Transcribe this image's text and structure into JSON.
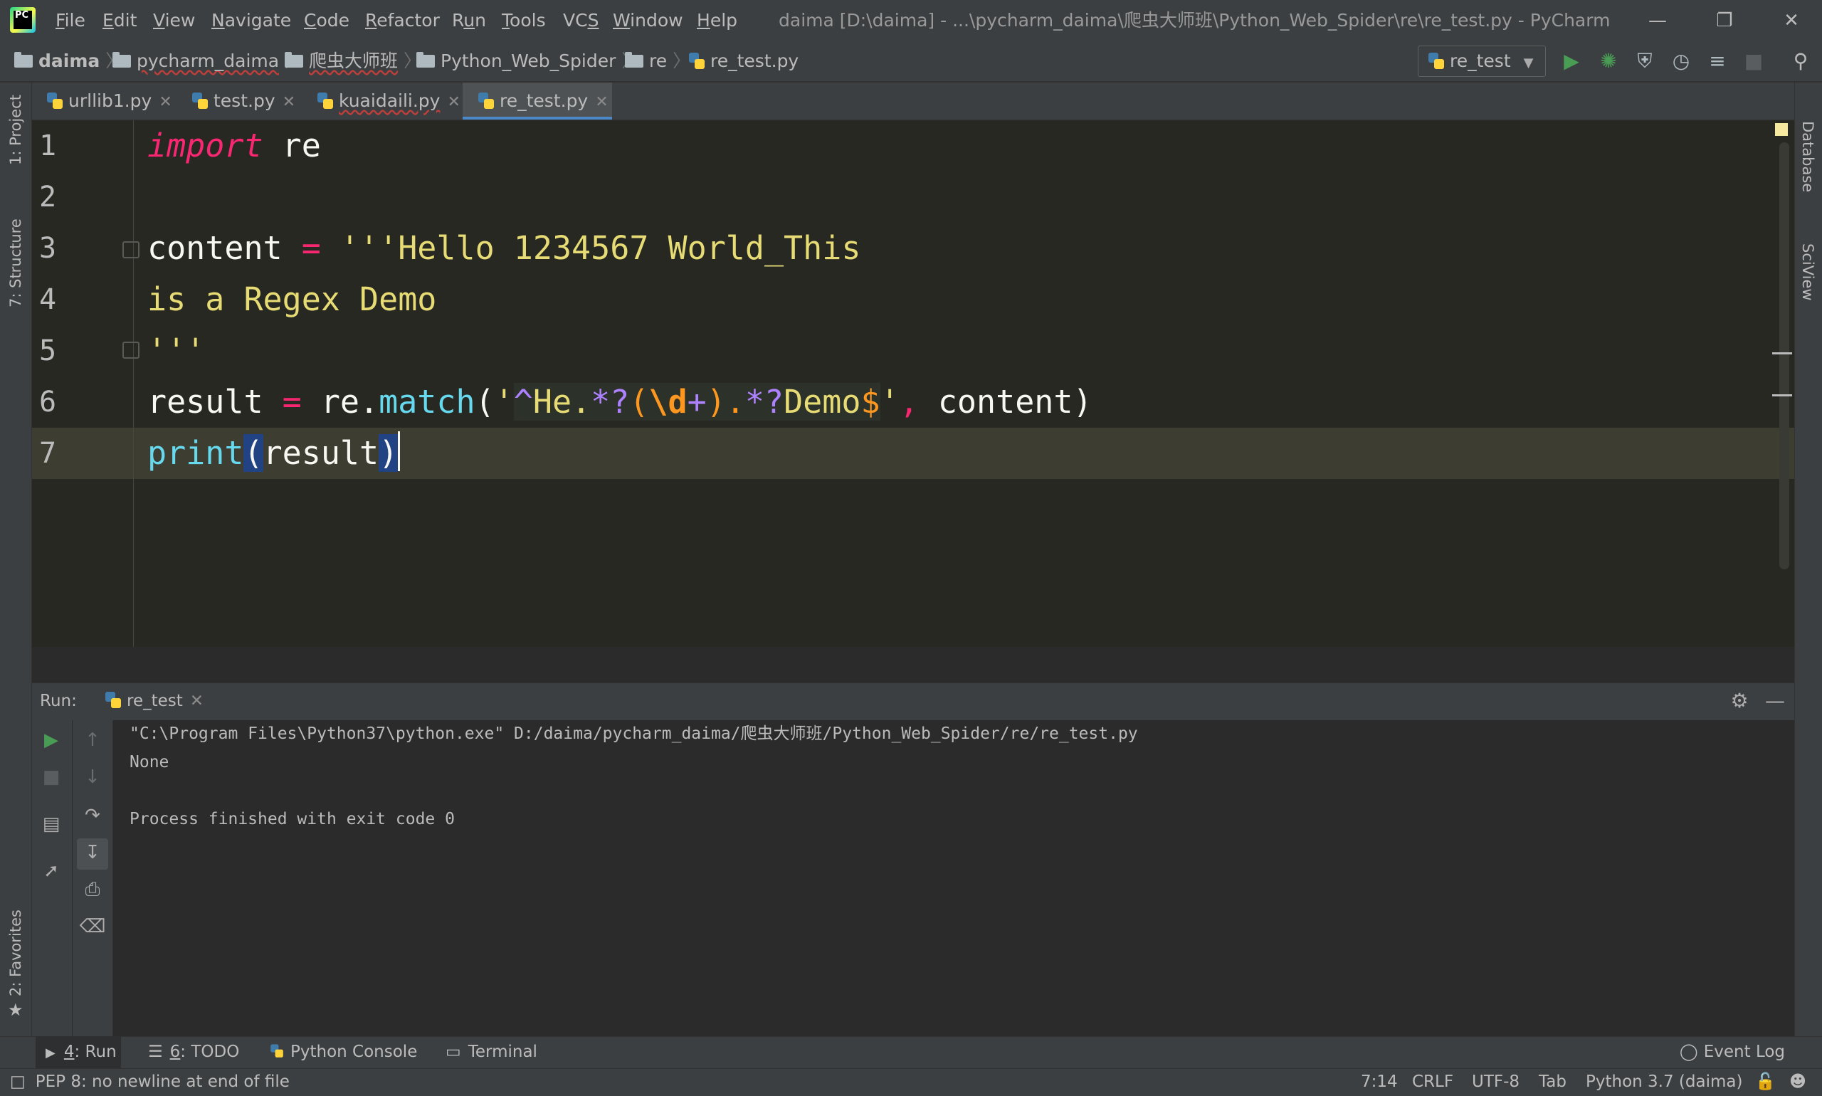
{
  "menu": {
    "items": [
      {
        "pre": "",
        "u": "F",
        "post": "ile"
      },
      {
        "pre": "",
        "u": "E",
        "post": "dit"
      },
      {
        "pre": "",
        "u": "V",
        "post": "iew"
      },
      {
        "pre": "",
        "u": "N",
        "post": "avigate"
      },
      {
        "pre": "",
        "u": "C",
        "post": "ode"
      },
      {
        "pre": "",
        "u": "R",
        "post": "efactor"
      },
      {
        "pre": "R",
        "u": "u",
        "post": "n"
      },
      {
        "pre": "",
        "u": "T",
        "post": "ools"
      },
      {
        "pre": "VC",
        "u": "S",
        "post": ""
      },
      {
        "pre": "",
        "u": "W",
        "post": "indow"
      },
      {
        "pre": "",
        "u": "H",
        "post": "elp"
      }
    ]
  },
  "window_title": "daima [D:\\daima] - ...\\pycharm_daima\\爬虫大师班\\Python_Web_Spider\\re\\re_test.py - PyCharm",
  "breadcrumb": [
    "daima",
    "pycharm_daima",
    "爬虫大师班",
    "Python_Web_Spider",
    "re",
    "re_test.py"
  ],
  "run_config": "re_test",
  "tabs": [
    "urllib1.py",
    "test.py",
    "kuaidaili.py",
    "re_test.py"
  ],
  "active_tab": "re_test.py",
  "editor": {
    "line_numbers": [
      "1",
      "2",
      "3",
      "4",
      "5",
      "6",
      "7"
    ],
    "line1": {
      "kw": "import",
      "rest": " re"
    },
    "line3": {
      "ident": "content ",
      "op": "=",
      "str": " '''Hello 1234567 World_This"
    },
    "line4": {
      "str": "is a Regex Demo"
    },
    "line5": {
      "str": "'''"
    },
    "line6": {
      "a": "result ",
      "op": "=",
      "b": " re.",
      "fn": "match",
      "c": "(",
      "q1": "'",
      "rx1": "^",
      "rx2": "He.",
      "rx3": "*?",
      "rx4": "(",
      "rx5": "\\d",
      "rx6": "+",
      "rx7": ").",
      "rx8": "*?",
      "rx9": "Demo",
      "rx10": "$",
      "q2": "'",
      "comma": ",",
      "d": " content)"
    },
    "line7": {
      "fn": "print",
      "open": "(",
      "arg": "result",
      "close": ")"
    }
  },
  "left_stripe": [
    "1: Project",
    "7: Structure",
    "2: Favorites"
  ],
  "right_stripe": [
    "Database",
    "SciView"
  ],
  "run": {
    "label": "Run:",
    "tab": "re_test",
    "output": [
      "\"C:\\Program Files\\Python37\\python.exe\" D:/daima/pycharm_daima/爬虫大师班/Python_Web_Spider/re/re_test.py",
      "None",
      "",
      "Process finished with exit code 0"
    ]
  },
  "toolwindows": [
    {
      "u": "4",
      "label": ": Run"
    },
    {
      "u": "6",
      "label": ": TODO"
    },
    {
      "u": "",
      "label": "Python Console"
    },
    {
      "u": "",
      "label": "Terminal"
    }
  ],
  "event_log": "Event Log",
  "status": {
    "message": "PEP 8: no newline at end of file",
    "position": "7:14",
    "line_sep": "CRLF",
    "encoding": "UTF-8",
    "indent": "Tab",
    "interpreter": "Python 3.7 (daima)"
  },
  "colors": {
    "accent": "#4a88c7",
    "keyword": "#f92672",
    "string": "#e6db74",
    "function": "#66d9ef",
    "run_green": "#499c54"
  }
}
